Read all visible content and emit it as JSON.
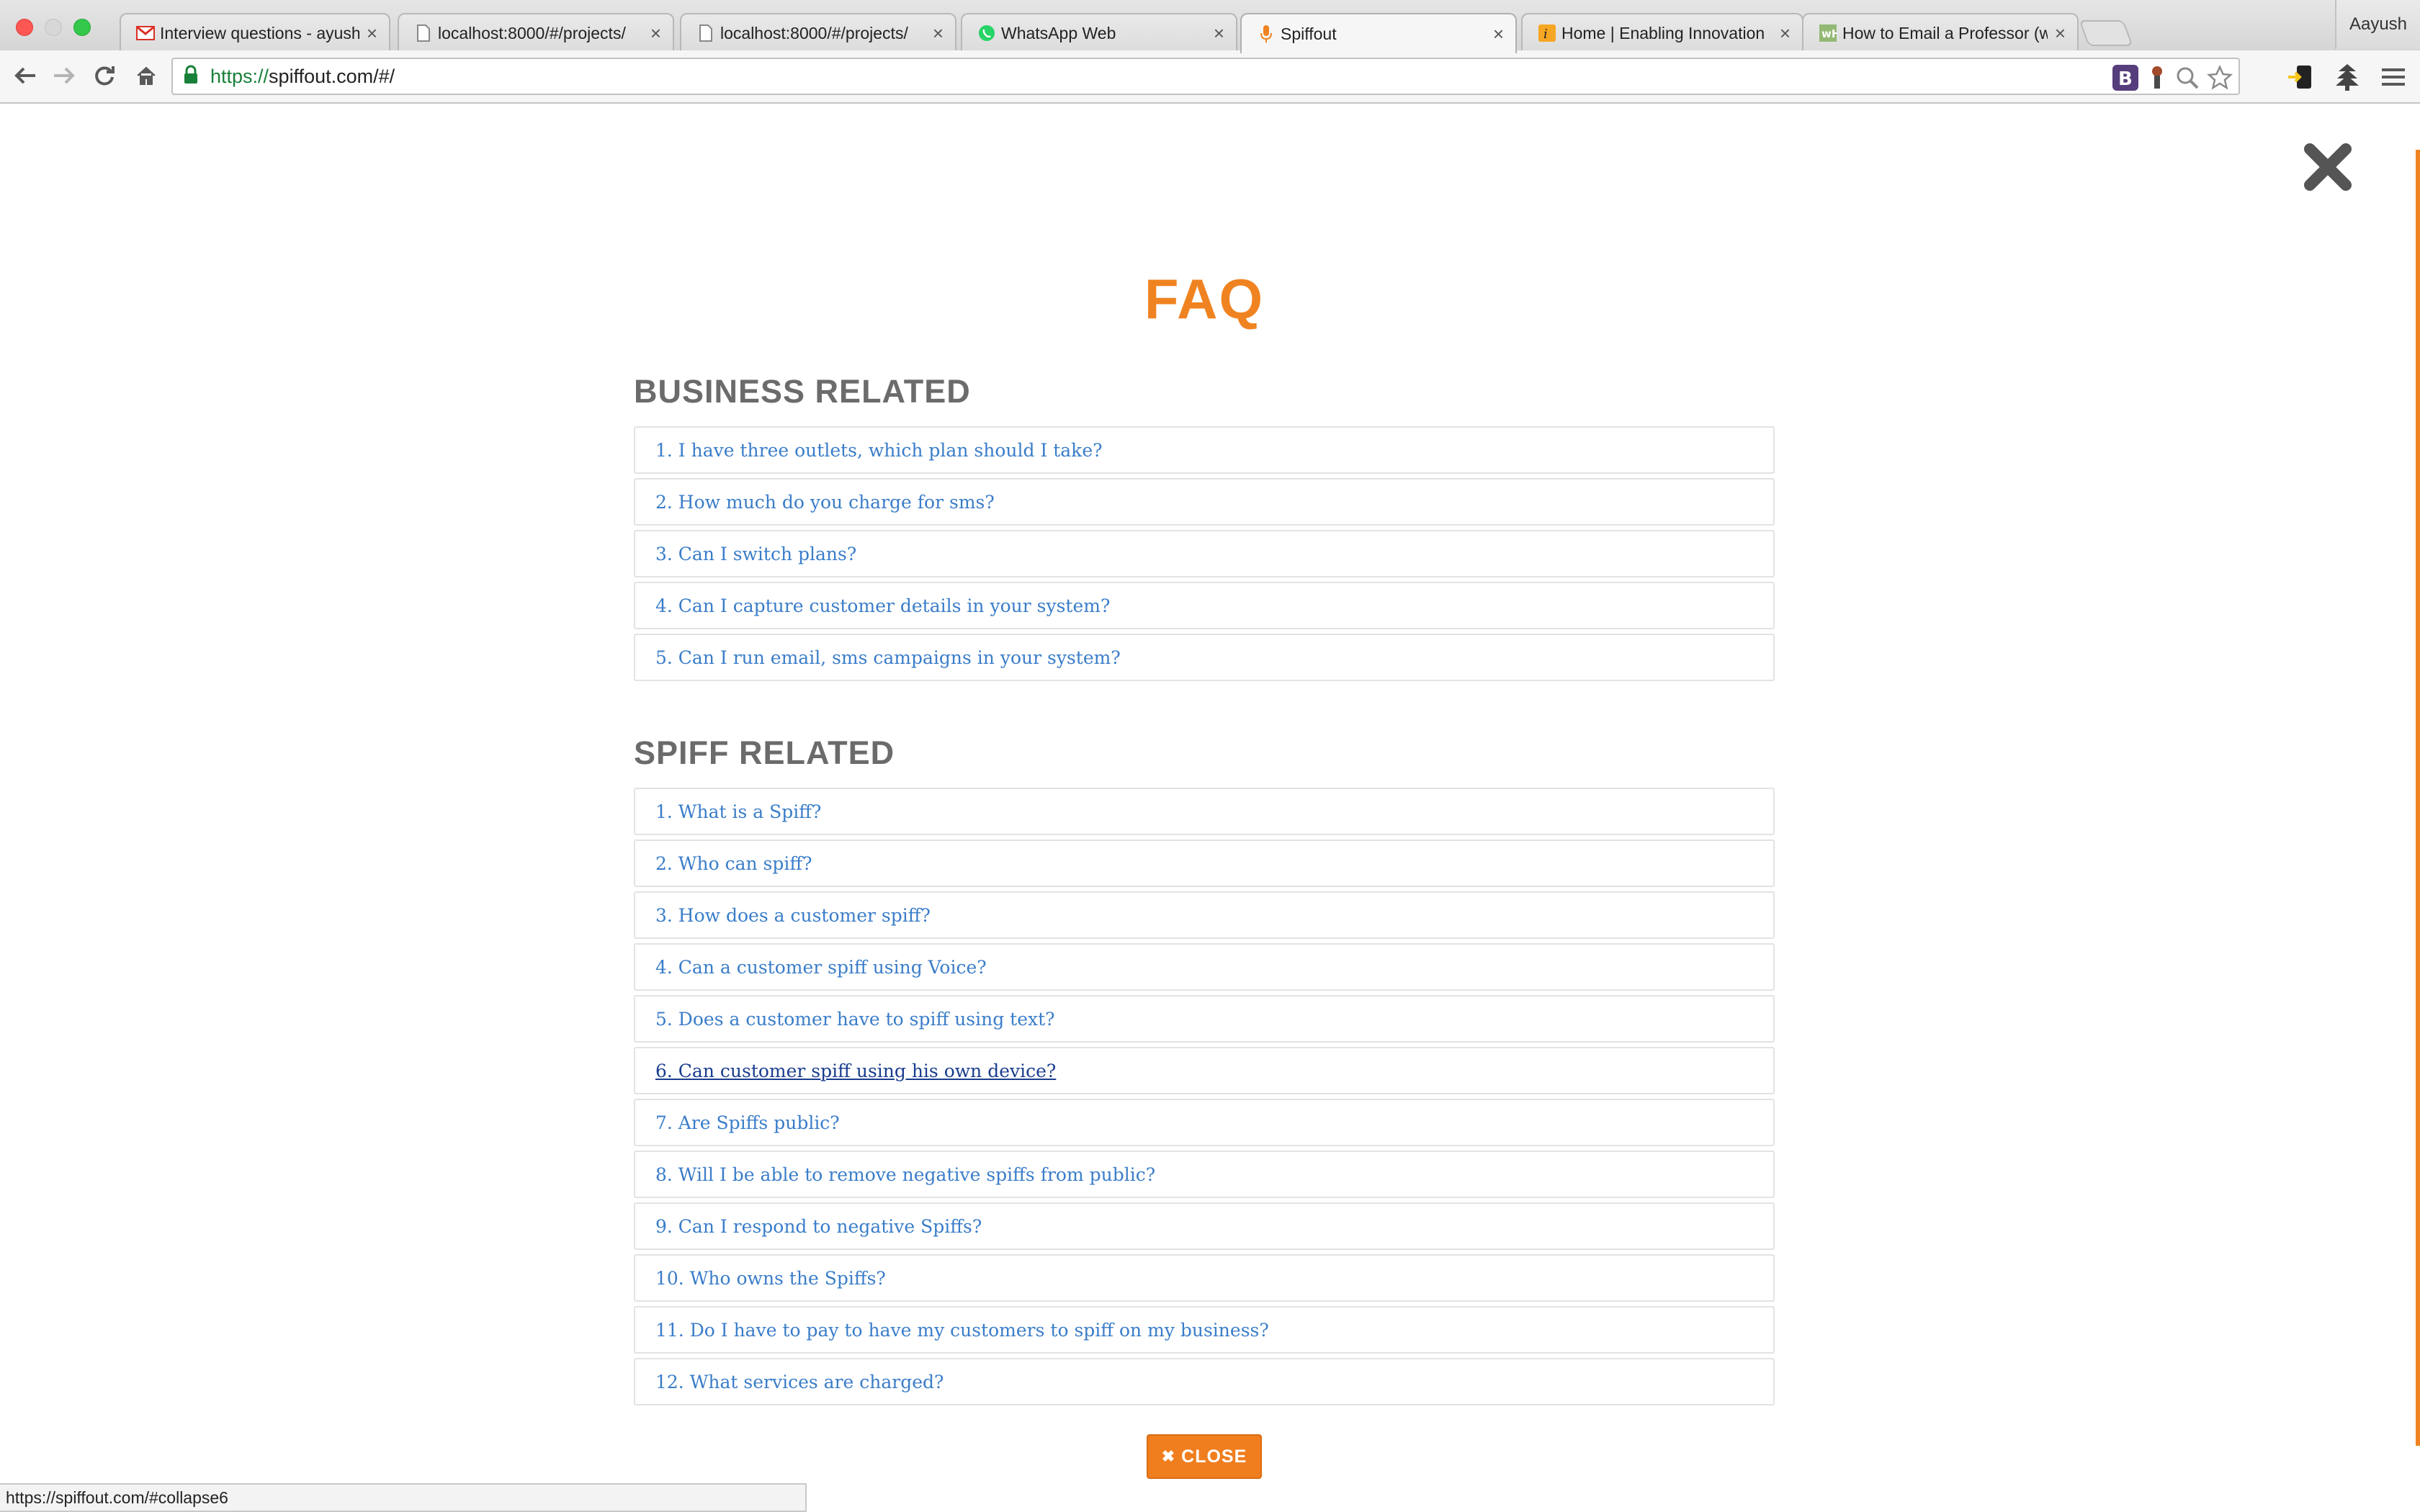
{
  "browser": {
    "tabs": [
      {
        "title": "Interview questions - ayush",
        "favicon": "gmail-icon"
      },
      {
        "title": "localhost:8000/#/projects/",
        "favicon": "page-icon"
      },
      {
        "title": "localhost:8000/#/projects/",
        "favicon": "page-icon"
      },
      {
        "title": "WhatsApp Web",
        "favicon": "whatsapp-icon"
      },
      {
        "title": "Spiffout",
        "favicon": "spiffout-icon",
        "active": true
      },
      {
        "title": "Home | Enabling Innovation",
        "favicon": "innovation-icon"
      },
      {
        "title": "How to Email a Professor (w",
        "favicon": "wikihow-icon"
      }
    ],
    "profile_name": "Aayush",
    "url_scheme": "https://",
    "url_rest": "spiffout.com/#/",
    "status_url": "https://spiffout.com/#collapse6"
  },
  "faq": {
    "title": "FAQ",
    "business": {
      "heading": "BUSINESS RELATED",
      "items": [
        "1. I have three outlets, which plan should I take?",
        "2. How much do you charge for sms?",
        "3. Can I switch plans?",
        "4. Can I capture customer details in your system?",
        "5. Can I run email, sms campaigns in your system?"
      ]
    },
    "spiff": {
      "heading": "SPIFF RELATED",
      "items": [
        "1. What is a Spiff?",
        "2. Who can spiff?",
        "3. How does a customer spiff?",
        "4. Can a customer spiff using Voice?",
        "5. Does a customer have to spiff using text?",
        "6. Can customer spiff using his own device?",
        "7. Are Spiffs public?",
        "8. Will I be able to remove negative spiffs from public?",
        "9. Can I respond to negative Spiffs?",
        "10. Who owns the Spiffs?",
        "11. Do I have to pay to have my customers to spiff on my business?",
        "12. What services are charged?"
      ]
    },
    "close_label": "CLOSE"
  },
  "colors": {
    "accent": "#f08321",
    "link": "#3a7dc9",
    "link_hover": "#1a3d8f",
    "heading": "#6b6b6b"
  }
}
